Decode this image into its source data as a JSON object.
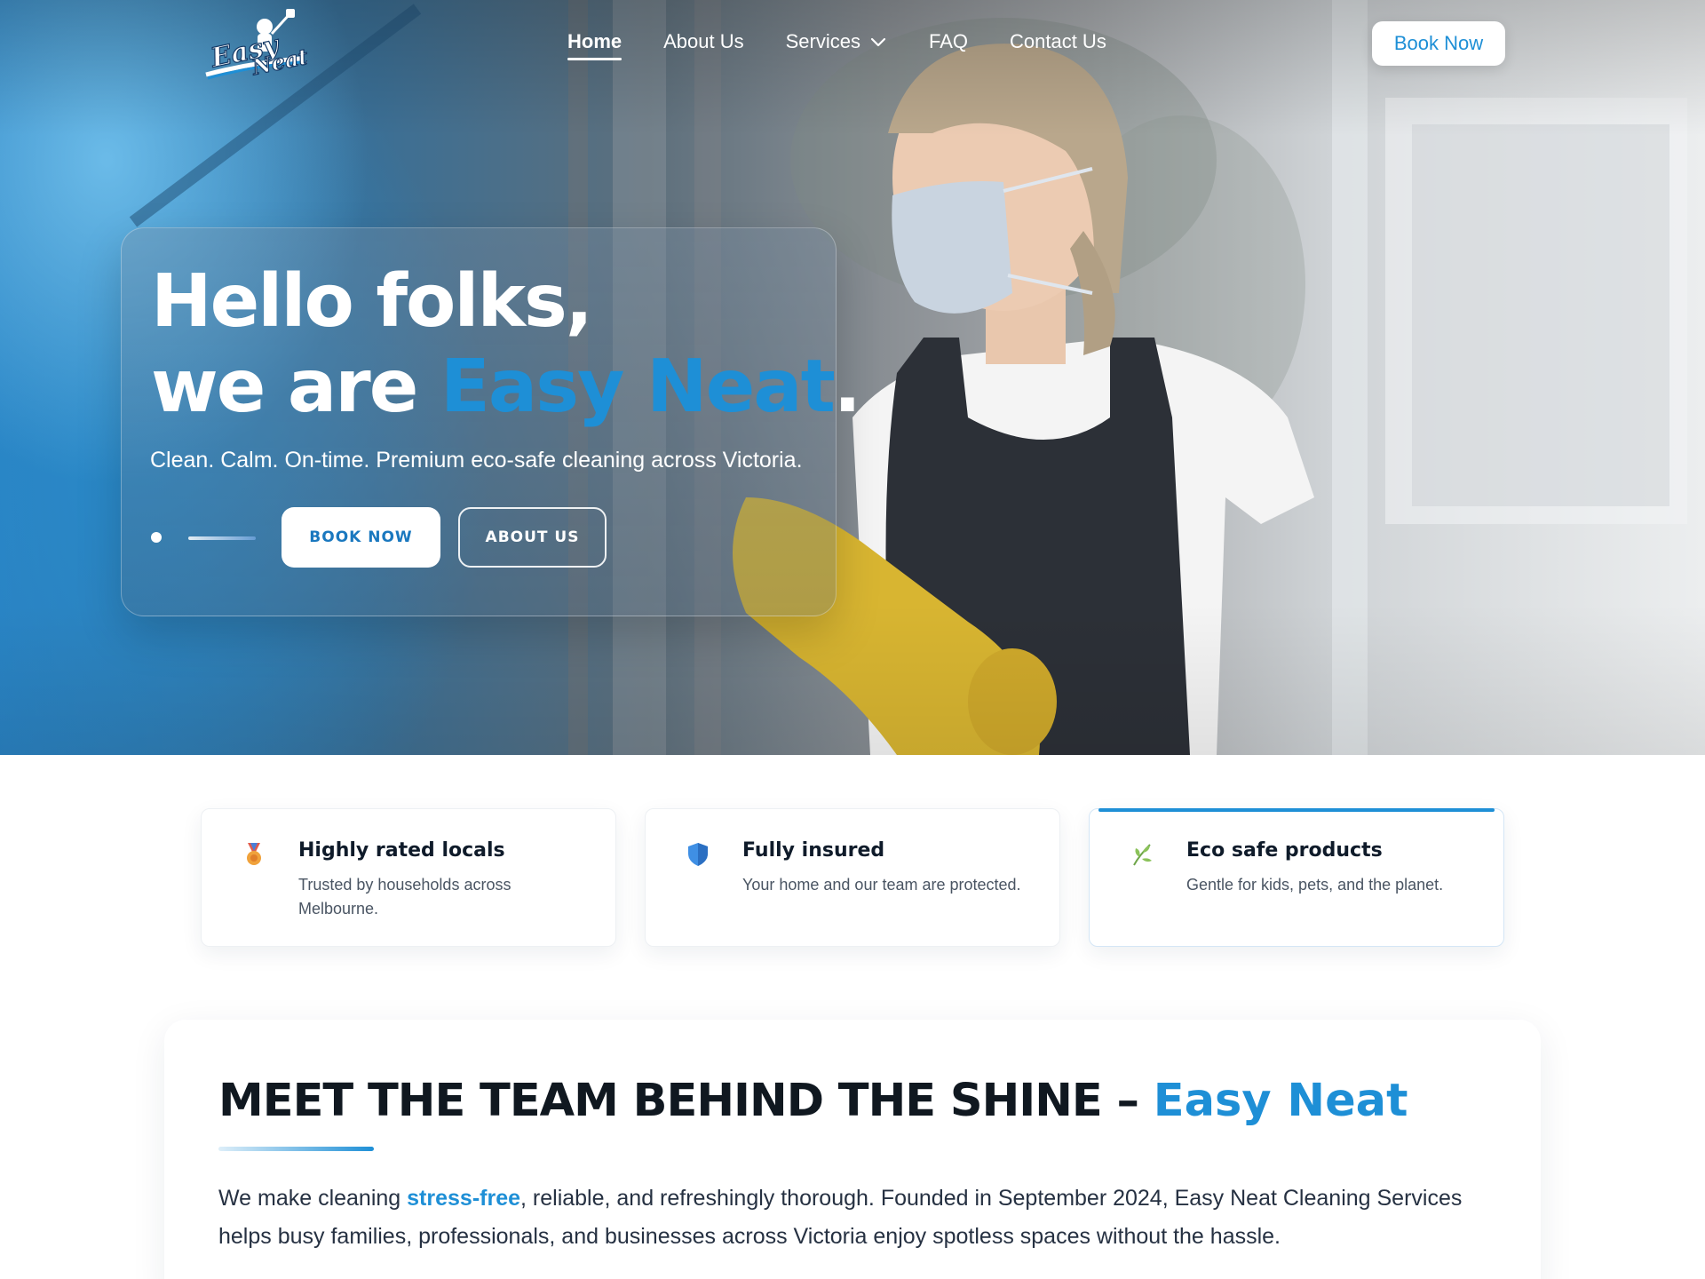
{
  "brand": {
    "logo_text_1": "Easy",
    "logo_text_2": "Neat",
    "accent": "#1e8fd6"
  },
  "nav": {
    "items": [
      {
        "label": "Home",
        "active": true
      },
      {
        "label": "About Us",
        "active": false
      },
      {
        "label": "Services",
        "active": false,
        "has_dropdown": true
      },
      {
        "label": "FAQ",
        "active": false
      },
      {
        "label": "Contact Us",
        "active": false
      }
    ],
    "cta_label": "Book Now"
  },
  "hero": {
    "title_line1": "Hello folks,",
    "title_line2_prefix": "we are ",
    "title_line2_accent": "Easy Neat",
    "title_line2_suffix": ".",
    "subtitle": "Clean. Calm. On-time. Premium eco-safe cleaning across Victoria.",
    "primary_button": "BOOK NOW",
    "secondary_button": "ABOUT US"
  },
  "features": [
    {
      "icon": "medal-icon",
      "title": "Highly rated locals",
      "desc": "Trusted by households across Melbourne."
    },
    {
      "icon": "shield-icon",
      "title": "Fully insured",
      "desc": "Your home and our team are protected."
    },
    {
      "icon": "leaf-icon",
      "title": "Eco safe products",
      "desc": "Gentle for kids, pets, and the planet.",
      "highlighted": true
    }
  ],
  "team": {
    "title_prefix": "MEET THE TEAM BEHIND THE SHINE – ",
    "title_accent": "Easy Neat",
    "text_prefix": "We make cleaning ",
    "text_highlight": "stress-free",
    "text_suffix": ", reliable, and refreshingly thorough. Founded in September 2024, Easy Neat Cleaning Services helps busy families, professionals, and businesses across Victoria enjoy spotless spaces without the hassle."
  }
}
